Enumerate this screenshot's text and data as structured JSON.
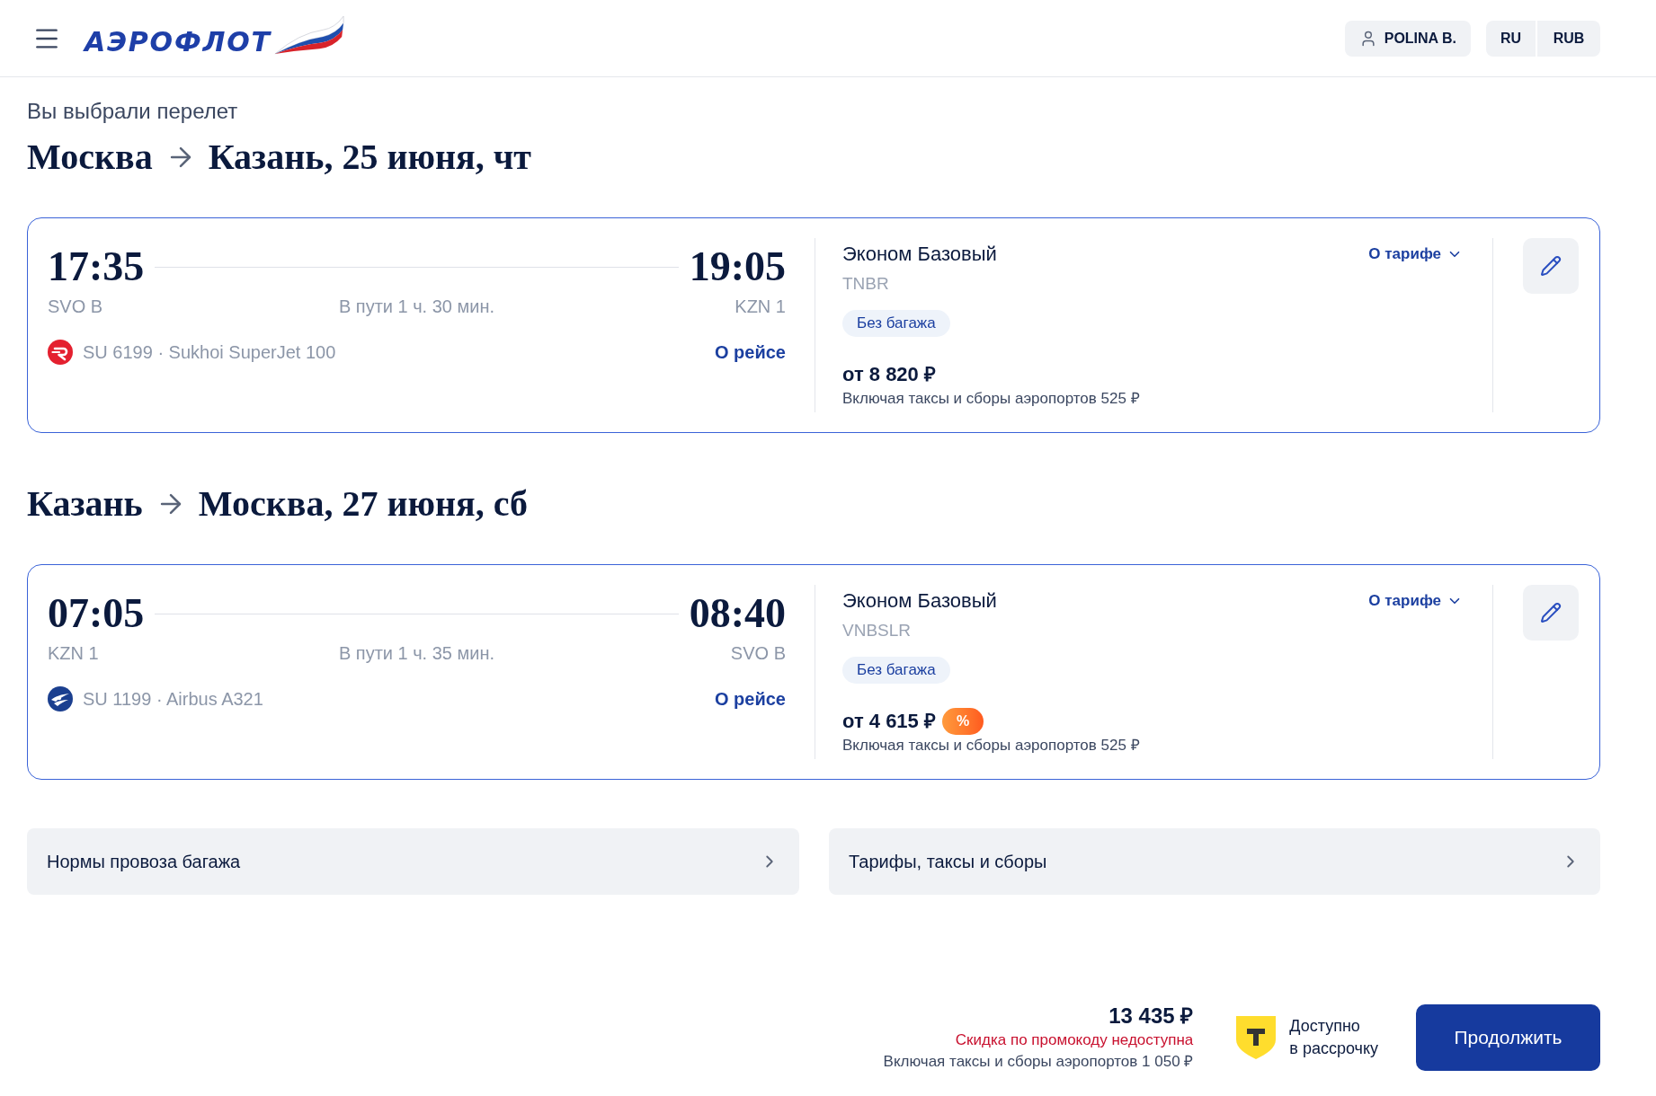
{
  "header": {
    "logo": "АЭРОФЛОТ",
    "user": "POLINA B.",
    "language": "RU",
    "currency": "RUB"
  },
  "intro": "Вы выбрали перелет",
  "segments": [
    {
      "route": {
        "from": "Москва",
        "to": "Казань, 25 июня, чт"
      },
      "departure": {
        "time": "17:35",
        "airport": "SVO B"
      },
      "arrival": {
        "time": "19:05",
        "airport": "KZN 1"
      },
      "duration": "В пути 1 ч. 30 мин.",
      "flight": {
        "kind": "r-mark",
        "info": "SU 6199 · Sukhoi SuperJet 100",
        "link": "О рейсе"
      },
      "fare": {
        "name": "Эконом Базовый",
        "code": "TNBR",
        "details_link": "О тарифе",
        "badge": "Без багажа",
        "price": "от 8 820 ₽",
        "taxes_note": "Включая таксы и сборы аэропортов 525 ₽"
      }
    },
    {
      "route": {
        "from": "Казань",
        "to": "Москва, 27 июня, сб"
      },
      "departure": {
        "time": "07:05",
        "airport": "KZN 1"
      },
      "arrival": {
        "time": "08:40",
        "airport": "SVO B"
      },
      "duration": "В пути 1 ч. 35 мин.",
      "flight": {
        "kind": "wing-mark",
        "info": "SU 1199 · Airbus A321",
        "link": "О рейсе"
      },
      "fare": {
        "name": "Эконом Базовый",
        "code": "VNBSLR",
        "details_link": "О тарифе",
        "badge": "Без багажа",
        "price": "от 4 615 ₽",
        "discount_badge": "%",
        "taxes_note": "Включая таксы и сборы аэропортов 525 ₽"
      }
    }
  ],
  "info_links": [
    "Нормы провоза багажа",
    "Тарифы, таксы и сборы"
  ],
  "footer": {
    "total": "13 435 ₽",
    "promo_warning": "Скидка по промокоду недоступна",
    "taxes_note": "Включая таксы и сборы аэропортов 1 050 ₽",
    "installment": "Доступно\nв рассрочку",
    "continue_button": "Продолжить"
  }
}
